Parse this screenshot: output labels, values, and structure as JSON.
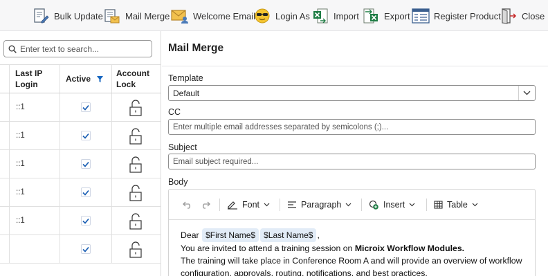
{
  "toolbar": {
    "items": [
      {
        "label": "Bulk Update",
        "icon": "bulk-update-icon"
      },
      {
        "label": "Mail Merge",
        "icon": "mail-merge-icon"
      },
      {
        "label": "Welcome Email",
        "icon": "welcome-email-icon"
      },
      {
        "label": "Login As",
        "icon": "login-as-icon"
      },
      {
        "label": "Import",
        "icon": "import-excel-icon"
      },
      {
        "label": "Export",
        "icon": "export-excel-icon"
      },
      {
        "label": "Register Product",
        "icon": "register-product-icon"
      },
      {
        "label": "Close",
        "icon": "close-door-icon"
      }
    ]
  },
  "grid": {
    "search_placeholder": "Enter text to search...",
    "columns": {
      "last_ip_line1": "Last IP",
      "last_ip_line2": "Login",
      "active": "Active",
      "account_lock_line1": "Account",
      "account_lock_line2": "Lock"
    },
    "rows": [
      {
        "last_ip": "::1",
        "active": true
      },
      {
        "last_ip": "::1",
        "active": true
      },
      {
        "last_ip": "::1",
        "active": true
      },
      {
        "last_ip": "::1",
        "active": true
      },
      {
        "last_ip": "::1",
        "active": true
      },
      {
        "last_ip": "",
        "active": true
      }
    ]
  },
  "form": {
    "title": "Mail Merge",
    "template_label": "Template",
    "template_value": "Default",
    "cc_label": "CC",
    "cc_placeholder": "Enter multiple email addresses separated by semicolons (;)...",
    "subject_label": "Subject",
    "subject_placeholder": "Email subject required...",
    "body_label": "Body",
    "editor_toolbar": {
      "font": "Font",
      "paragraph": "Paragraph",
      "insert": "Insert",
      "table": "Table"
    },
    "body": {
      "greeting": "Dear",
      "chip_first": "$First Name$",
      "chip_last": "$Last Name$",
      "comma": ",",
      "line2_pre": "You are invited to attend a training session on ",
      "line2_bold": "Microix Workflow Modules.",
      "line3": "The training will take place in Conference Room A and will provide an overview of workflow",
      "line4": "configuration, approvals, routing, notifications, and best practices."
    }
  },
  "colors": {
    "accent": "#1a5fb4",
    "filter_icon": "#1565c0",
    "chip_bg": "#e2ecf7"
  }
}
